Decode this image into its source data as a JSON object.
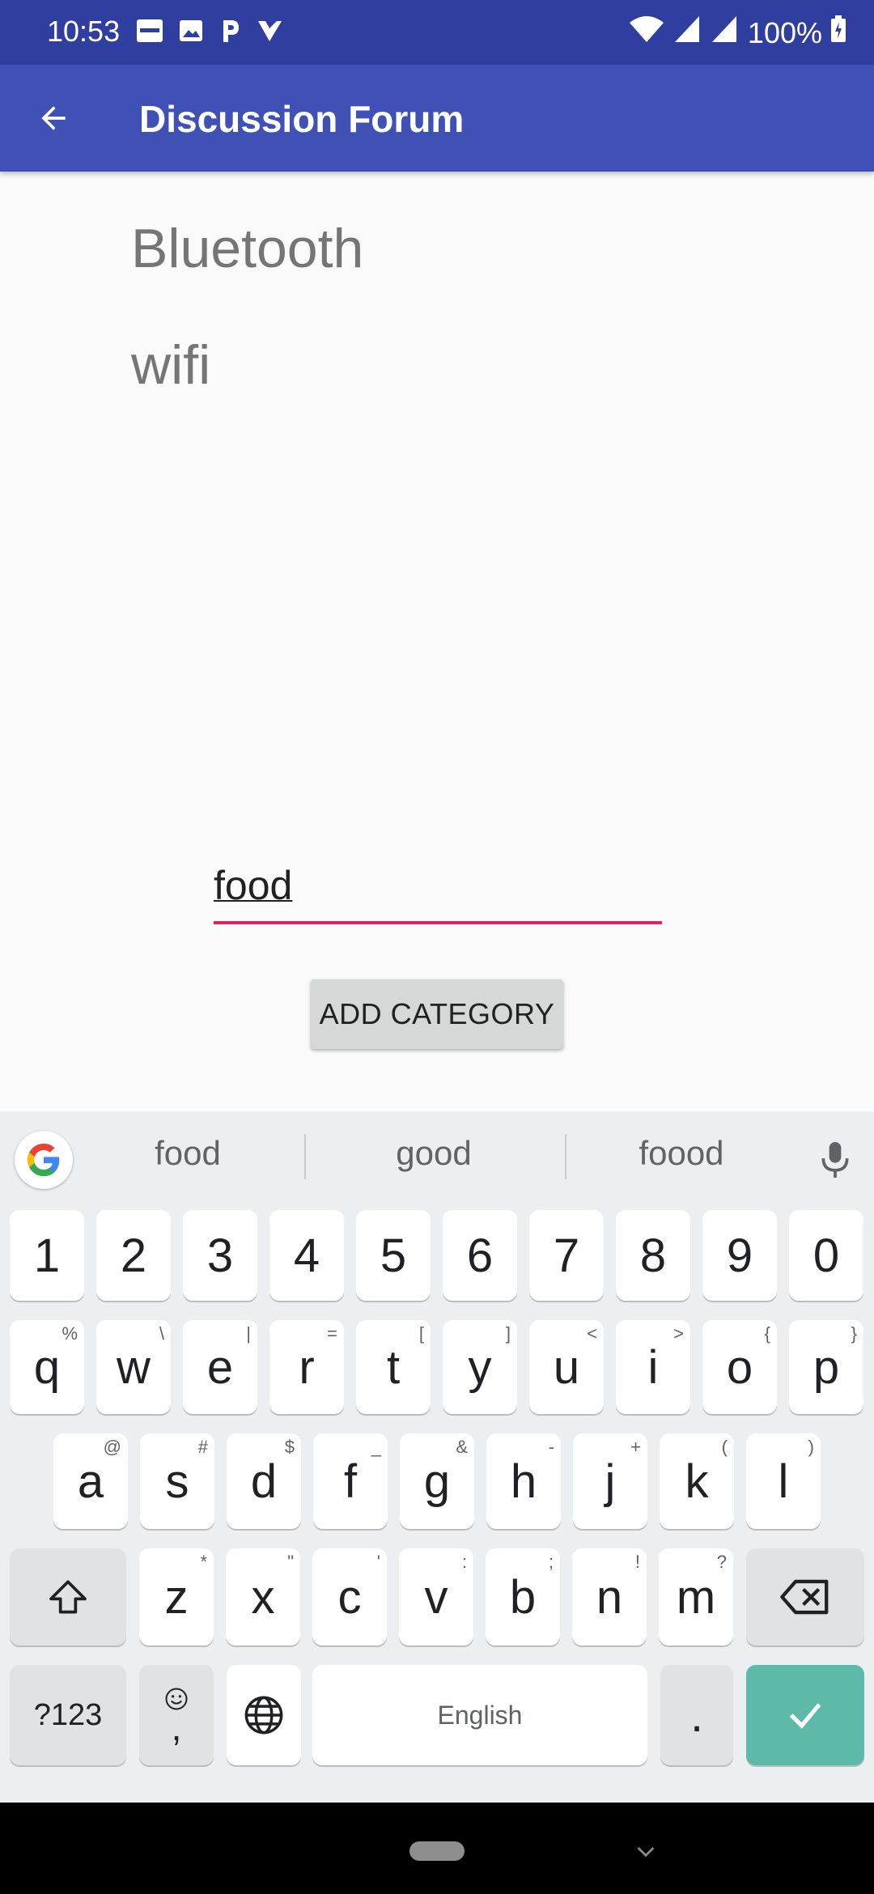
{
  "status_bar": {
    "time": "10:53",
    "battery": "100%",
    "notif_icons": [
      "zomato-icon",
      "image-icon",
      "parking-icon",
      "check-icon"
    ]
  },
  "app_bar": {
    "title": "Discussion Forum"
  },
  "categories": [
    "Bluetooth",
    "wifi"
  ],
  "category_input": {
    "value": "food",
    "placeholder": ""
  },
  "add_button": {
    "label": "ADD CATEGORY"
  },
  "keyboard": {
    "suggestions": [
      "food",
      "good",
      "foood"
    ],
    "row1": [
      "1",
      "2",
      "3",
      "4",
      "5",
      "6",
      "7",
      "8",
      "9",
      "0"
    ],
    "row2": [
      {
        "k": "q",
        "h": "%"
      },
      {
        "k": "w",
        "h": "\\"
      },
      {
        "k": "e",
        "h": "|"
      },
      {
        "k": "r",
        "h": "="
      },
      {
        "k": "t",
        "h": "["
      },
      {
        "k": "y",
        "h": "]"
      },
      {
        "k": "u",
        "h": "<"
      },
      {
        "k": "i",
        "h": ">"
      },
      {
        "k": "o",
        "h": "{"
      },
      {
        "k": "p",
        "h": "}"
      }
    ],
    "row3": [
      {
        "k": "a",
        "h": "@"
      },
      {
        "k": "s",
        "h": "#"
      },
      {
        "k": "d",
        "h": "$"
      },
      {
        "k": "f",
        "h": "_"
      },
      {
        "k": "g",
        "h": "&"
      },
      {
        "k": "h",
        "h": "-"
      },
      {
        "k": "j",
        "h": "+"
      },
      {
        "k": "k",
        "h": "("
      },
      {
        "k": "l",
        "h": ")"
      }
    ],
    "row4": [
      {
        "k": "z",
        "h": "*"
      },
      {
        "k": "x",
        "h": "\""
      },
      {
        "k": "c",
        "h": "'"
      },
      {
        "k": "v",
        "h": ":"
      },
      {
        "k": "b",
        "h": ";"
      },
      {
        "k": "n",
        "h": "!"
      },
      {
        "k": "m",
        "h": "?"
      }
    ],
    "sym_label": "?123",
    "comma_label": ",",
    "space_label": "English",
    "period_label": "."
  },
  "colors": {
    "status_bar": "#303f9f",
    "app_bar": "#3f51b5",
    "input_accent": "#e91e63",
    "enter_key": "#5dbaa8"
  }
}
